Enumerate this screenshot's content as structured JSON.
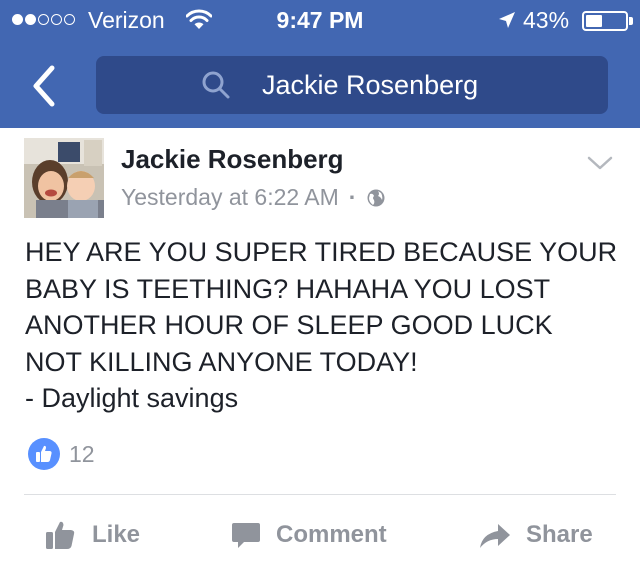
{
  "status_bar": {
    "carrier": "Verizon",
    "time": "9:47 PM",
    "battery_percent": "43%",
    "battery_level": 0.43,
    "signal_bars": 2,
    "signal_total": 5
  },
  "nav": {
    "back_icon": "chevron-left-icon",
    "search_icon": "search-icon",
    "search_text": "Jackie Rosenberg"
  },
  "post": {
    "author": "Jackie Rosenberg",
    "timestamp": "Yesterday at 6:22 AM",
    "separator": "·",
    "privacy_icon": "globe-icon",
    "menu_icon": "chevron-down-icon",
    "lines": [
      "HEY ARE YOU SUPER TIRED BECAUSE YOUR",
      "BABY IS TEETHING? HAHAHA YOU LOST",
      "ANOTHER HOUR OF SLEEP GOOD LUCK",
      "NOT KILLING ANYONE TODAY!",
      "- Daylight savings"
    ],
    "like_count": "12"
  },
  "actions": {
    "like": "Like",
    "comment": "Comment",
    "share": "Share"
  },
  "colors": {
    "header": "#4267b2",
    "search_field": "#2f4a8a",
    "muted_text": "#90949c",
    "like_blue": "#5890ff"
  }
}
